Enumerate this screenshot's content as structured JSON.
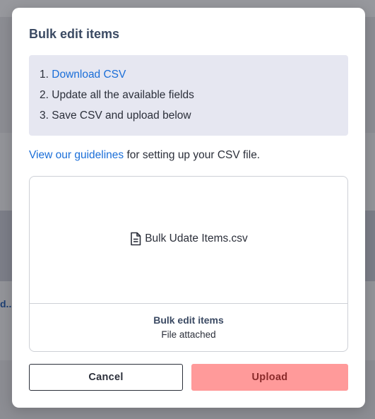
{
  "background": {
    "fragment_text": "d..."
  },
  "modal": {
    "title": "Bulk edit items",
    "steps": [
      {
        "number": "1.",
        "text": "Download CSV",
        "is_link": true
      },
      {
        "number": "2.",
        "text": "Update all the available fields",
        "is_link": false
      },
      {
        "number": "3.",
        "text": "Save CSV and upload below",
        "is_link": false
      }
    ],
    "guideline": {
      "link_text": "View our guidelines",
      "rest_text": " for setting up your CSV file."
    },
    "dropzone": {
      "file_icon": "file-text-icon",
      "file_name": "Bulk Udate Items.csv",
      "status_title": "Bulk edit items",
      "status_subtitle": "File attached"
    },
    "buttons": {
      "cancel": "Cancel",
      "upload": "Upload"
    }
  },
  "colors": {
    "link": "#1a6ed8",
    "upload_button": "#ff9a9a",
    "steps_background": "#e6e7f1"
  }
}
